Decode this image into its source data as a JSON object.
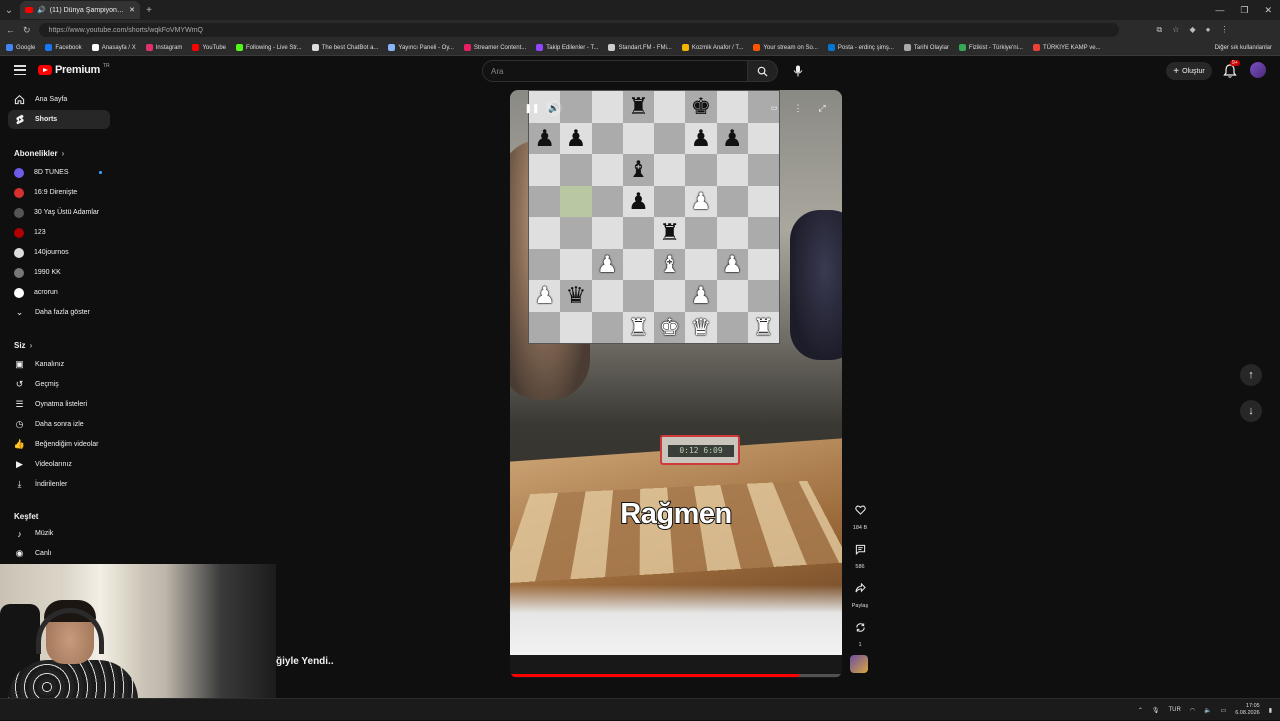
{
  "browser": {
    "tab_title": "(11) Dünya Şampiyonunu Kendi...",
    "url": "https://www.youtube.com/shorts/wqkFoVMYWmQ",
    "bookmarks": [
      {
        "label": "Google",
        "color": "#4285f4"
      },
      {
        "label": "Facebook",
        "color": "#1877f2"
      },
      {
        "label": "Anasayfa / X",
        "color": "#ffffff"
      },
      {
        "label": "Instagram",
        "color": "#e1306c"
      },
      {
        "label": "YouTube",
        "color": "#ff0000"
      },
      {
        "label": "Following - Live Str...",
        "color": "#53fc18"
      },
      {
        "label": "The best ChatBot a...",
        "color": "#dddddd"
      },
      {
        "label": "Yayıncı Paneli - Oy...",
        "color": "#8ab4f8"
      },
      {
        "label": "Streamer Content...",
        "color": "#e91e63"
      },
      {
        "label": "Takip Edilenler - T...",
        "color": "#9146ff"
      },
      {
        "label": "Standart.FM - FMi...",
        "color": "#cccccc"
      },
      {
        "label": "Kozmik Anafor / T...",
        "color": "#f4b400"
      },
      {
        "label": "Your stream on So...",
        "color": "#ff5500"
      },
      {
        "label": "Posta - erdinç şimş...",
        "color": "#0078d4"
      },
      {
        "label": "Tarihi Olaylar",
        "color": "#aaaaaa"
      },
      {
        "label": "Fizikist - Türkiye'ni...",
        "color": "#34a853"
      },
      {
        "label": "TÜRKIYE KAMP ve...",
        "color": "#ea4335"
      }
    ],
    "bookmarks_other": "Diğer sık kullanılanlar"
  },
  "masthead": {
    "logo_text": "Premium",
    "logo_sup": "TR",
    "search_placeholder": "Ara",
    "create_label": "Oluştur",
    "notif_count": "9+"
  },
  "sidebar": {
    "home": "Ana Sayfa",
    "shorts": "Shorts",
    "subscriptions_header": "Abonelikler",
    "subscriptions": [
      {
        "label": "8D TUNES",
        "color": "#6c5ce7"
      },
      {
        "label": "16:9 Direnişte",
        "color": "#d63031"
      },
      {
        "label": "30 Yaş Üstü Adamlar",
        "color": "#555555"
      },
      {
        "label": "123",
        "color": "#b00000"
      },
      {
        "label": "140journos",
        "color": "#dddddd"
      },
      {
        "label": "1990 KK",
        "color": "#777777"
      },
      {
        "label": "acrorun",
        "color": "#ffffff"
      }
    ],
    "show_more": "Daha fazla göster",
    "you_header": "Siz",
    "you_items": [
      {
        "label": "Kanalınız",
        "icon": "user-square-icon"
      },
      {
        "label": "Geçmiş",
        "icon": "history-icon"
      },
      {
        "label": "Oynatma listeleri",
        "icon": "playlist-icon"
      },
      {
        "label": "Daha sonra izle",
        "icon": "clock-icon"
      },
      {
        "label": "Beğendiğim videolar",
        "icon": "thumbs-up-icon"
      },
      {
        "label": "Videolarınız",
        "icon": "video-icon"
      },
      {
        "label": "İndirilenler",
        "icon": "download-icon"
      }
    ],
    "explore_header": "Keşfet",
    "explore_items": [
      {
        "label": "Müzik",
        "icon": "music-icon"
      },
      {
        "label": "Canlı",
        "icon": "live-icon"
      }
    ]
  },
  "short": {
    "caption": "Rağmen",
    "clock_text": "0:12  6:09",
    "progress": 0.87,
    "title_partial": "ğiyle Yendi.."
  },
  "actions": {
    "likes": "184 B",
    "comments": "586",
    "share": "Paylaş",
    "remix": "1"
  },
  "board": [
    [
      "",
      "",
      "",
      "br",
      "",
      "bk",
      "",
      ""
    ],
    [
      "bp",
      "bp",
      "",
      "",
      "",
      "bp",
      "bp",
      ""
    ],
    [
      "",
      "",
      "",
      "bb",
      "",
      "",
      "",
      ""
    ],
    [
      "",
      "",
      "",
      "bp",
      "",
      "wp",
      "",
      ""
    ],
    [
      "",
      "",
      "",
      "",
      "br",
      "",
      "",
      ""
    ],
    [
      "",
      "",
      "wp",
      "",
      "wb",
      "",
      "wp",
      ""
    ],
    [
      "wp",
      "bq",
      "",
      "",
      "",
      "wp",
      "",
      ""
    ],
    [
      "",
      "",
      "",
      "wr",
      "wk",
      "wq",
      "",
      "wr"
    ]
  ],
  "taskbar": {
    "lang": "TUR",
    "time": "17:05",
    "date": "6.08.2026"
  }
}
